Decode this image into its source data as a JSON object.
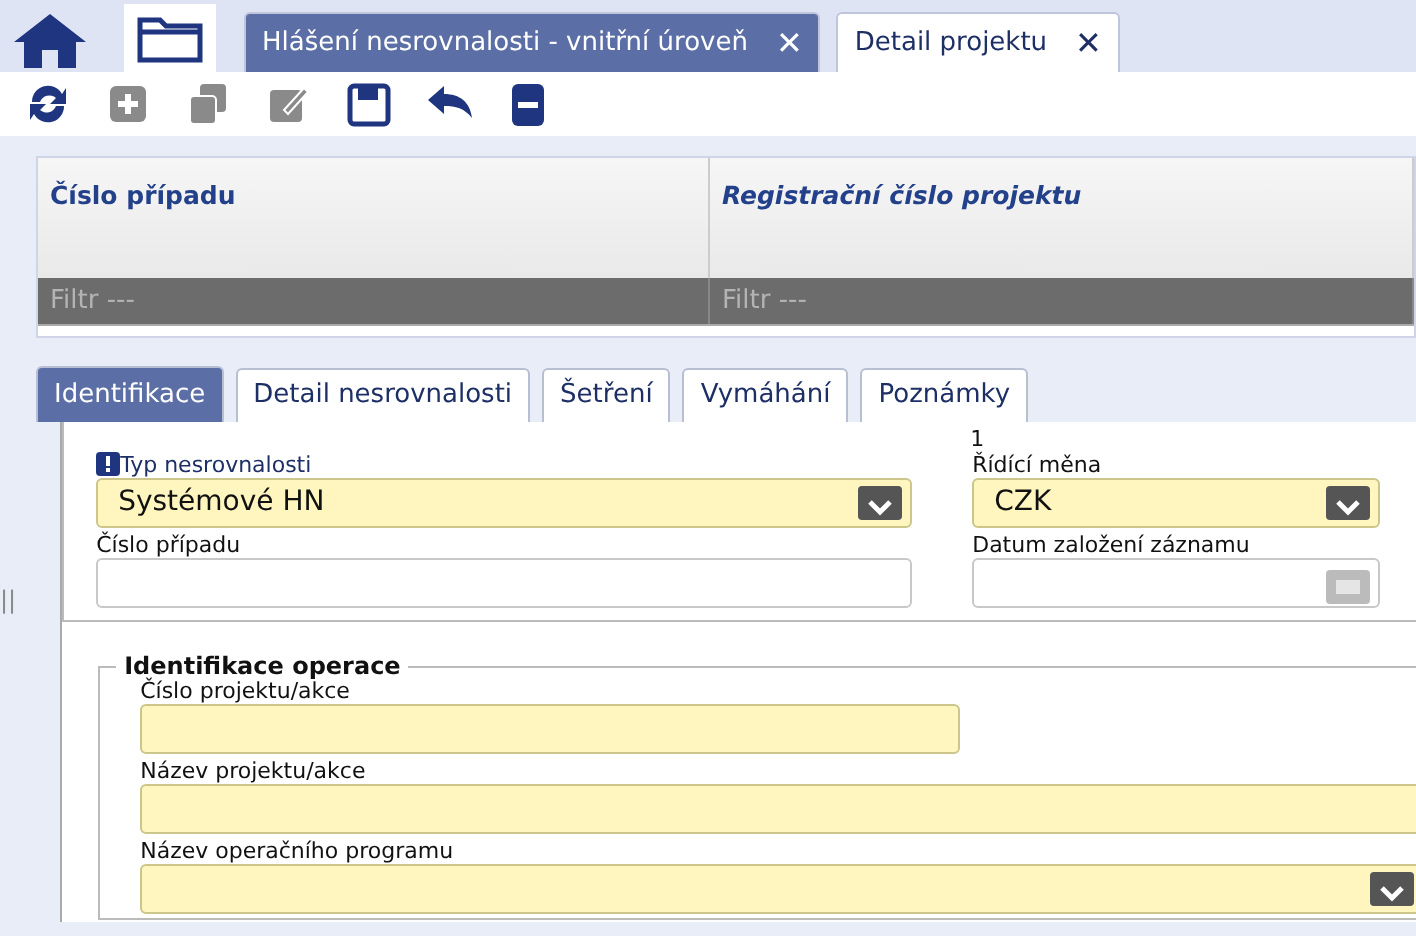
{
  "doc_tabs": [
    {
      "label": "Hlášení nesrovnalosti - vnitřní úroveň",
      "close": "✕",
      "selected": true
    },
    {
      "label": "Detail projektu",
      "close": "✕",
      "selected": false
    }
  ],
  "toolbar": [
    {
      "kind": "refresh",
      "disabled": false
    },
    {
      "kind": "add",
      "disabled": true
    },
    {
      "kind": "copy",
      "disabled": true
    },
    {
      "kind": "edit",
      "disabled": true
    },
    {
      "kind": "save",
      "disabled": false
    },
    {
      "kind": "undo",
      "disabled": false
    },
    {
      "kind": "remove",
      "disabled": false
    }
  ],
  "grid": {
    "columns": [
      {
        "label": "Číslo případu",
        "italic": false,
        "filter_placeholder": "Filtr ---"
      },
      {
        "label": "Registrační číslo projektu",
        "italic": true,
        "filter_placeholder": "Filtr ---"
      }
    ]
  },
  "form_tabs": [
    {
      "label": "Identifikace",
      "selected": true
    },
    {
      "label": "Detail nesrovnalosti",
      "selected": false
    },
    {
      "label": "Šetření",
      "selected": false
    },
    {
      "label": "Vymáhání",
      "selected": false
    },
    {
      "label": "Poznámky",
      "selected": false
    }
  ],
  "splitter": "||",
  "section1": {
    "counter": "1",
    "fields": [
      {
        "kind": "select",
        "label": "Typ nesrovnalosti",
        "value": "Systémové HN",
        "required": true,
        "info": true
      },
      {
        "kind": "select",
        "label": "Řídící měna",
        "value": "CZK",
        "required": true,
        "info": false
      },
      {
        "kind": "text",
        "label": "Číslo případu",
        "required": false,
        "info": false
      },
      {
        "kind": "date",
        "label": "Datum založení záznamu",
        "required": false,
        "info": false
      }
    ]
  },
  "section2": {
    "title": "Identifikace operace",
    "fields": [
      {
        "kind": "text",
        "label": "Číslo projektu/akce",
        "required": true
      },
      {
        "kind": "text",
        "label": "Název projektu/akce",
        "required": true
      },
      {
        "kind": "select",
        "label": "Název operačního programu",
        "required": true
      }
    ]
  }
}
